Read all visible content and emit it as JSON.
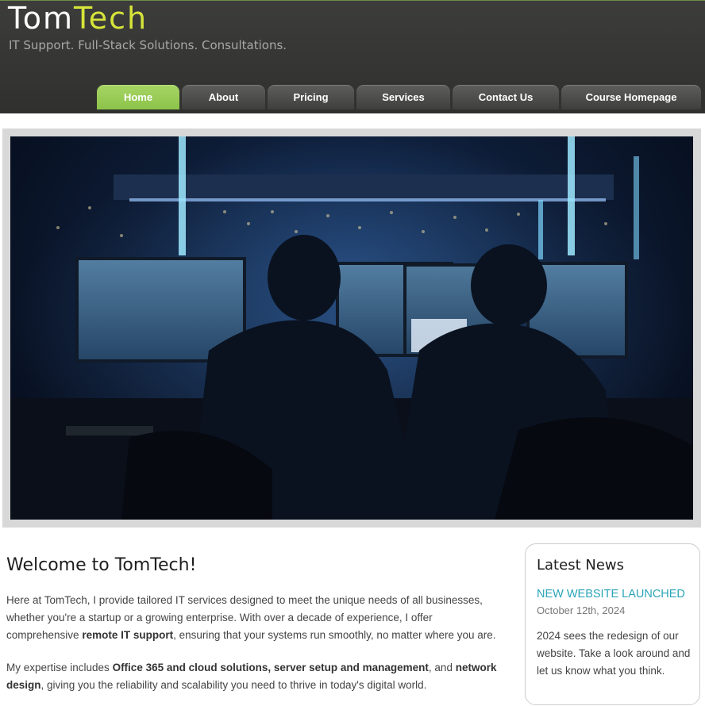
{
  "site": {
    "logo_part1": "Tom",
    "logo_part2": "Tech",
    "tagline": "IT Support. Full-Stack Solutions. Consultations.",
    "colors": {
      "header_bg": "#333432",
      "accent": "#d6e43a",
      "active_tab": "#9ccd55",
      "link": "#2aa4b7"
    }
  },
  "nav": {
    "tabs": [
      {
        "label": "Home",
        "active": true
      },
      {
        "label": "About"
      },
      {
        "label": "Pricing"
      },
      {
        "label": "Services"
      },
      {
        "label": "Contact Us"
      },
      {
        "label": "Course Homepage"
      }
    ]
  },
  "hero": {
    "image": "two-people-at-server-room-monitors"
  },
  "main": {
    "title": "Welcome to TomTech!",
    "p1": {
      "text1": "Here at TomTech, I provide tailored IT services designed to meet the unique needs of all businesses, whether you're a startup or a growing enterprise. With over a decade of experience, I offer comprehensive ",
      "bold1": "remote IT support",
      "text2": ", ensuring that your systems run smoothly, no matter where you are."
    },
    "p2": {
      "text1": "My expertise includes ",
      "bold1": "Office 365 and cloud solutions, server setup and management",
      "text2": ", and ",
      "bold2": "network design",
      "text3": ", giving you the reliability and scalability you need to thrive in today's digital world."
    }
  },
  "sidebar": {
    "heading": "Latest News",
    "news": [
      {
        "title": "NEW WEBSITE LAUNCHED",
        "date": "October 12th, 2024",
        "body": "2024 sees the redesign of our website. Take a look around and let us know what you think."
      }
    ]
  }
}
